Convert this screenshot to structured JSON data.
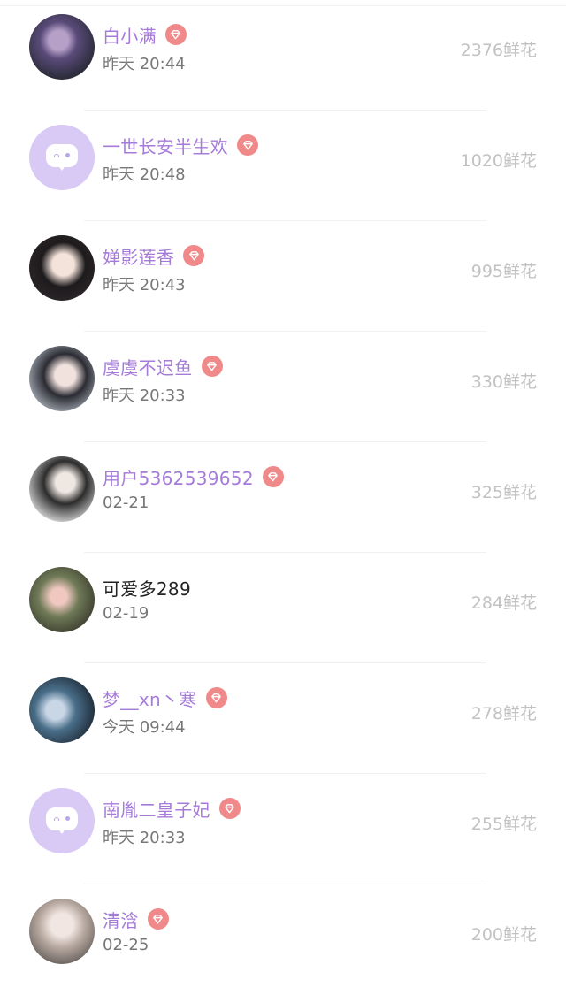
{
  "rows": [
    {
      "name": "白小满",
      "time": "昨天 20:44",
      "flowers": "2376鲜花",
      "vip": true,
      "avatar": "photo1",
      "plain": false
    },
    {
      "name": "一世长安半生欢",
      "time": "昨天 20:48",
      "flowers": "1020鲜花",
      "vip": true,
      "avatar": "placeholder",
      "plain": false
    },
    {
      "name": "婵影莲香",
      "time": "昨天 20:43",
      "flowers": "995鲜花",
      "vip": true,
      "avatar": "photo2",
      "plain": false
    },
    {
      "name": "虞虞不迟鱼",
      "time": "昨天 20:33",
      "flowers": "330鲜花",
      "vip": true,
      "avatar": "photo3",
      "plain": false
    },
    {
      "name": "用户5362539652",
      "time": "02-21",
      "flowers": "325鲜花",
      "vip": true,
      "avatar": "photo4",
      "plain": false
    },
    {
      "name": "可爱多289",
      "time": "02-19",
      "flowers": "284鲜花",
      "vip": false,
      "avatar": "photo5",
      "plain": true
    },
    {
      "name": "梦__xn丶寒",
      "time": "今天 09:44",
      "flowers": "278鲜花",
      "vip": true,
      "avatar": "photo6",
      "plain": false
    },
    {
      "name": "南胤二皇子妃",
      "time": "昨天 20:33",
      "flowers": "255鲜花",
      "vip": true,
      "avatar": "placeholder",
      "plain": false
    },
    {
      "name": "清浛",
      "time": "02-25",
      "flowers": "200鲜花",
      "vip": true,
      "avatar": "photo7",
      "plain": false
    }
  ]
}
